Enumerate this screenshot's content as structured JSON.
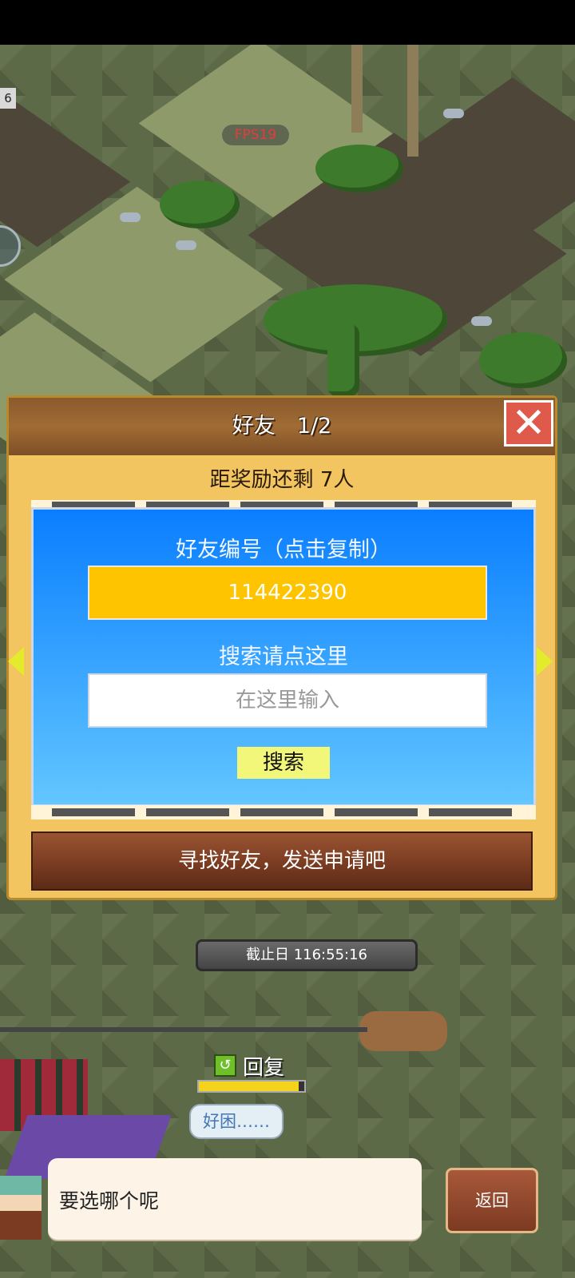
{
  "hud": {
    "fps": "FPS19",
    "side_tag": "6"
  },
  "friend_panel": {
    "title": "好友　1/2",
    "close_icon": "close-icon",
    "reward_text": "距奖励还剩 7人",
    "friend_id_label": "好友编号（点击复制）",
    "friend_id": "114422390",
    "search_label": "搜索请点这里",
    "search_placeholder": "在这里输入",
    "search_button": "搜索",
    "send_request_label": "寻找好友，发送申请吧",
    "nav_left_icon": "arrow-left-icon",
    "nav_right_icon": "arrow-right-icon",
    "colors": {
      "panel": "#f2c560",
      "header": "#8a5b2c",
      "blue_area": "#1e8fff",
      "id_box": "#ffc400",
      "search_button": "#f2f77a"
    }
  },
  "deadline": "截止日 116:55:16",
  "character_status": {
    "recover_label": "回复",
    "stamina_fraction": 0.95,
    "speech": "好困……"
  },
  "dialog": {
    "text": "要选哪个呢",
    "back_button": "返回"
  }
}
